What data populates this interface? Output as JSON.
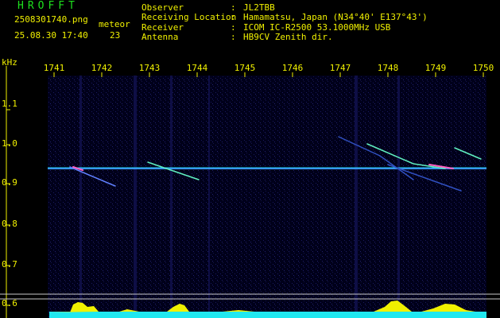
{
  "header": {
    "app_title": "HROFFT",
    "filename": "2508301740.png",
    "meteor_label": "meteor",
    "timestamp": "25.08.30 17:40",
    "meteor_count": "23"
  },
  "info": [
    {
      "key": "Observer",
      "value": "JL2TBB"
    },
    {
      "key": "Receiving Location",
      "value": "Hamamatsu, Japan (N34°40' E137°43')"
    },
    {
      "key": "Receiver",
      "value": "ICOM IC-R2500 53.1000MHz USB"
    },
    {
      "key": "Antenna",
      "value": "HB9CV Zenith dir."
    }
  ],
  "info_separator": ":",
  "plot": {
    "unit": "kHz",
    "y_labels": [
      "1.1",
      "1.0",
      "0.9",
      "0.8",
      "0.7",
      "0.6"
    ],
    "x_labels": [
      "1741",
      "1742",
      "1743",
      "1744",
      "1745",
      "1746",
      "1747",
      "1748",
      "1749",
      "1750"
    ],
    "colors": {
      "text": "#f0f000",
      "title": "#1ee01e",
      "carrier": "#3aa0ff",
      "baseline": "#20e8f0",
      "meteor": "#60f0c0"
    }
  }
}
